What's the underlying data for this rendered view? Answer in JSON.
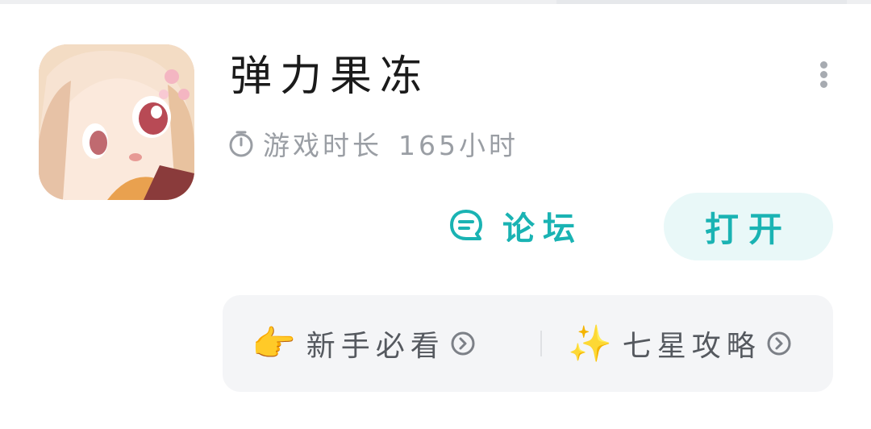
{
  "app": {
    "title": "弹力果冻",
    "playtime_label": "游戏时长",
    "playtime_value": "165小时"
  },
  "actions": {
    "forum_label": "论坛",
    "open_label": "打开"
  },
  "guides": [
    {
      "emoji": "👉",
      "label": "新手必看"
    },
    {
      "emoji": "✨",
      "label": "七星攻略"
    }
  ],
  "colors": {
    "accent": "#1ab3b3",
    "open_button_bg": "#e9f8f8",
    "muted_text": "#9a9ea4",
    "card_bg": "#f4f5f7"
  },
  "icons": [
    "clock-icon",
    "forum-chat-icon",
    "more-vertical-icon",
    "chevron-right-circle-icon"
  ]
}
